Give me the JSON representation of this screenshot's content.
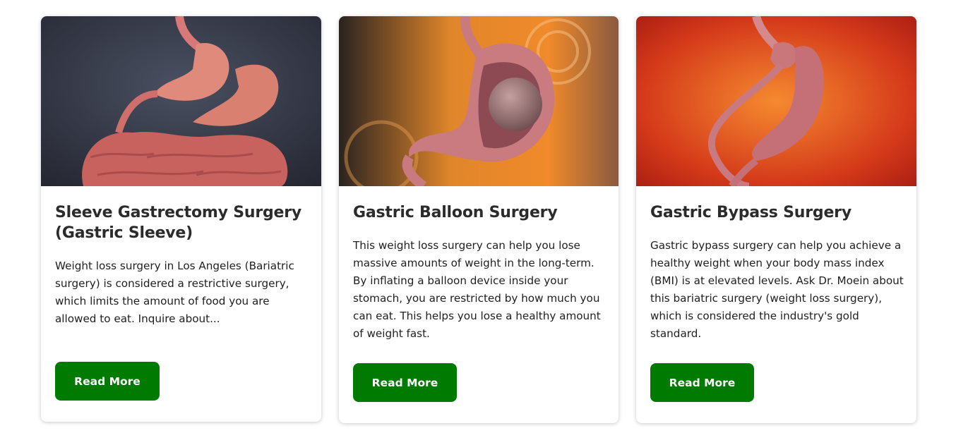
{
  "cards": [
    {
      "title": "Sleeve Gastrectomy Surgery (Gastric Sleeve)",
      "text": "Weight loss surgery in Los Angeles (Bariatric surgery) is considered a restrictive surgery, which limits the amount of food you are allowed to eat. Inquire about...",
      "button_label": "Read More",
      "image": "stomach-and-intestines-illustration"
    },
    {
      "title": "Gastric Balloon Surgery",
      "text": "This weight loss surgery can help you lose massive amounts of weight in the long-term. By inflating a balloon device inside your stomach, you are restricted by how much you can eat. This helps you lose a healthy amount of weight fast.",
      "button_label": "Read More",
      "image": "stomach-with-balloon-illustration"
    },
    {
      "title": "Gastric Bypass Surgery",
      "text": "Gastric bypass surgery can help you achieve a healthy weight when your body mass index (BMI) is at elevated levels. Ask Dr. Moein about this bariatric surgery (weight loss surgery), which is considered the industry's gold standard.",
      "button_label": "Read More",
      "image": "gastric-bypass-stomach-illustration"
    }
  ],
  "colors": {
    "button": "#007a00",
    "button_text": "#ffffff",
    "title": "#2b2b2b",
    "body_text": "#1f1f1f"
  }
}
